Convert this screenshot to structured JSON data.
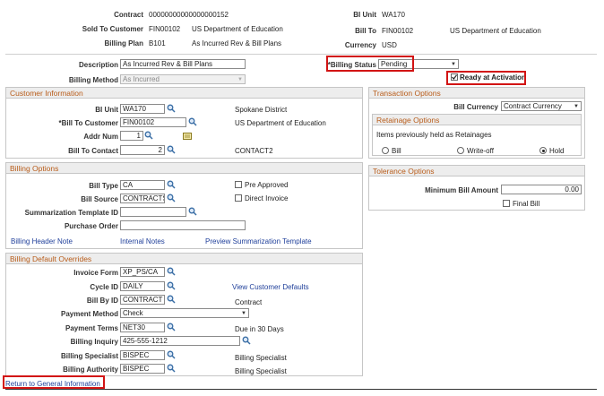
{
  "header": {
    "contract_label": "Contract",
    "contract_value": "00000000000000000152",
    "bi_unit_label": "BI Unit",
    "bi_unit_value": "WA170",
    "sold_to_label": "Sold To Customer",
    "sold_to_id": "FIN00102",
    "sold_to_name": "US Department of Education",
    "bill_to_label": "Bill To",
    "bill_to_id": "FIN00102",
    "bill_to_name": "US Department of Education",
    "billing_plan_label": "Billing Plan",
    "billing_plan_id": "B101",
    "billing_plan_name": "As Incurred Rev & Bill Plans",
    "currency_label": "Currency",
    "currency_value": "USD"
  },
  "description_label": "Description",
  "description_value": "As Incurred Rev & Bill Plans",
  "billing_status_label": "*Billing Status",
  "billing_status_value": "Pending",
  "billing_method_label": "Billing Method",
  "billing_method_value": "As Incurred",
  "ready_label": "Ready at Activation",
  "customer_info": {
    "title": "Customer Information",
    "bi_unit_label": "BI Unit",
    "bi_unit_value": "WA170",
    "bi_unit_desc": "Spokane District",
    "bill_to_label": "*Bill To Customer",
    "bill_to_value": "FIN00102",
    "bill_to_desc": "US Department of Education",
    "addr_label": "Addr Num",
    "addr_value": "1",
    "contact_label": "Bill To Contact",
    "contact_value": "2",
    "contact_desc": "CONTACT2"
  },
  "transaction_options": {
    "title": "Transaction Options",
    "bill_currency_label": "Bill Currency",
    "bill_currency_value": "Contract Currency",
    "retainage_title": "Retainage Options",
    "retainage_text": "Items previously held as Retainages",
    "radio_bill": "Bill",
    "radio_writeoff": "Write-off",
    "radio_hold": "Hold"
  },
  "billing_options": {
    "title": "Billing Options",
    "bill_type_label": "Bill Type",
    "bill_type_value": "CA",
    "bill_source_label": "Bill Source",
    "bill_source_value": "CONTRACTS",
    "summ_label": "Summarization Template ID",
    "summ_value": "",
    "po_label": "Purchase Order",
    "po_value": "",
    "pre_approved": "Pre Approved",
    "direct_invoice": "Direct Invoice",
    "link_header_note": "Billing Header Note",
    "link_internal_notes": "Internal Notes",
    "link_preview": "Preview Summarization Template"
  },
  "tolerance_options": {
    "title": "Tolerance Options",
    "min_bill_label": "Minimum Bill Amount",
    "min_bill_value": "0.00",
    "final_bill": "Final Bill"
  },
  "default_overrides": {
    "title": "Billing Default Overrides",
    "invoice_form_label": "Invoice Form",
    "invoice_form_value": "XP_PS/CA",
    "cycle_label": "Cycle ID",
    "cycle_value": "DAILY",
    "view_customer_defaults": "View Customer Defaults",
    "bill_by_label": "Bill By ID",
    "bill_by_value": "CONTRACT",
    "bill_by_desc": "Contract",
    "payment_method_label": "Payment Method",
    "payment_method_value": "Check",
    "payment_terms_label": "Payment Terms",
    "payment_terms_value": "NET30",
    "payment_terms_desc": "Due in 30 Days",
    "inquiry_label": "Billing Inquiry",
    "inquiry_value": "425-555-1212",
    "specialist_label": "Billing Specialist",
    "specialist_value": "BISPEC",
    "specialist_desc": "Billing Specialist",
    "authority_label": "Billing Authority",
    "authority_value": "BISPEC",
    "authority_desc": "Billing Specialist"
  },
  "return_link": "Return to General Information",
  "colors": {
    "highlight": "#d21414",
    "section_title": "#b85c1a",
    "link": "#1f3f9a"
  }
}
